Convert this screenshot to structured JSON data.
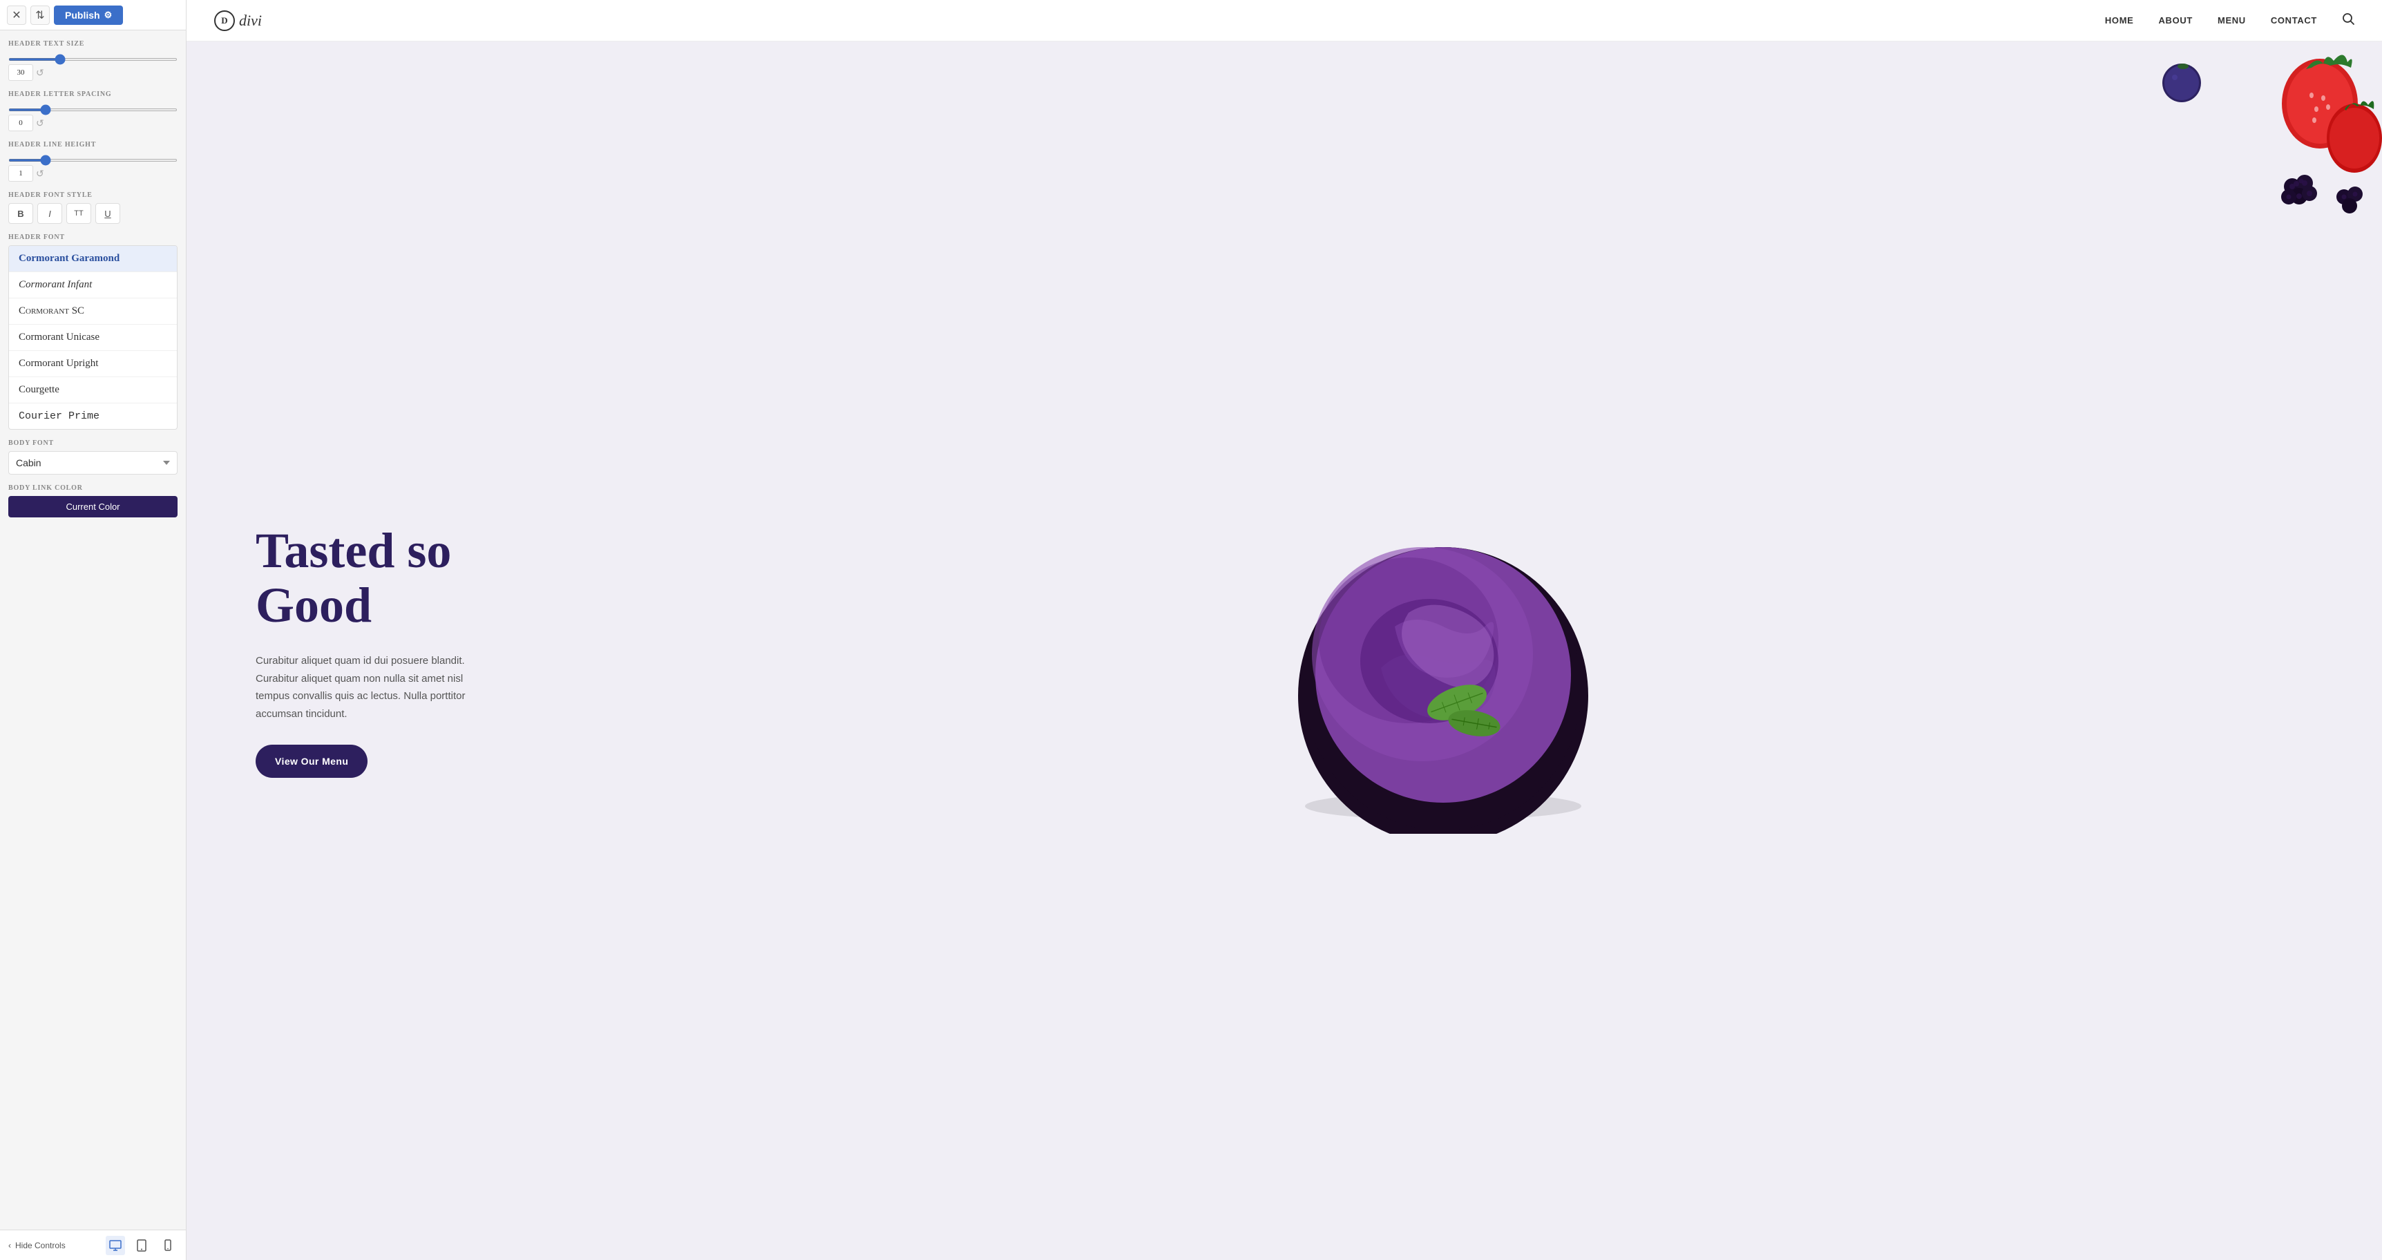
{
  "topBar": {
    "publishLabel": "Publish",
    "gearIcon": "⚙",
    "closeIcon": "✕",
    "sortIcon": "⇅"
  },
  "controls": {
    "headerTextSize": {
      "label": "HEADER TEXT SIZE",
      "value": "30",
      "min": 1,
      "max": 100,
      "sliderPercent": 30
    },
    "headerLetterSpacing": {
      "label": "HEADER LETTER SPACING",
      "value": "0",
      "min": -5,
      "max": 20,
      "sliderPercent": 20
    },
    "headerLineHeight": {
      "label": "HEADER LINE HEIGHT",
      "value": "1",
      "min": 0,
      "max": 5,
      "sliderPercent": 20
    },
    "headerFontStyle": {
      "label": "HEADER FONT STYLE",
      "buttons": [
        "B",
        "I",
        "TT",
        "U"
      ]
    },
    "headerFont": {
      "label": "HEADER FONT",
      "fonts": [
        {
          "name": "Cormorant Garamond",
          "active": true
        },
        {
          "name": "Cormorant Infant",
          "active": false
        },
        {
          "name": "Cormorant SC",
          "active": false
        },
        {
          "name": "Cormorant Unicase",
          "active": false
        },
        {
          "name": "Cormorant Upright",
          "active": false
        },
        {
          "name": "Courgette",
          "active": false
        },
        {
          "name": "Courier Prime",
          "active": false
        }
      ]
    },
    "bodyFont": {
      "label": "BODY FONT",
      "value": "Cabin"
    },
    "bodyLinkColor": {
      "label": "BODY LINK COLOR",
      "buttonLabel": "Current Color"
    }
  },
  "bottomBar": {
    "hideControlsLabel": "Hide Controls",
    "chevronIcon": "‹",
    "desktopIcon": "🖥",
    "tabletIcon": "📱",
    "mobileIcon": "📱"
  },
  "siteHeader": {
    "logoText": "divi",
    "logoLetter": "D",
    "nav": {
      "home": "HOME",
      "about": "ABOUT",
      "menu": "MENU",
      "contact": "CONTACT"
    }
  },
  "hero": {
    "heading": "Tasted so Good",
    "body": "Curabitur aliquet quam id dui posuere blandit. Curabitur aliquet quam non nulla sit amet nisl tempus convallis quis ac lectus. Nulla porttitor accumsan tincidunt.",
    "ctaLabel": "View Our Menu"
  },
  "colors": {
    "accent": "#2d1f5e",
    "brand": "#3b6fc9",
    "heroBg": "#f0eef5",
    "bowlPurple": "#7b3fa0",
    "bowlDark": "#1a0a2e"
  }
}
